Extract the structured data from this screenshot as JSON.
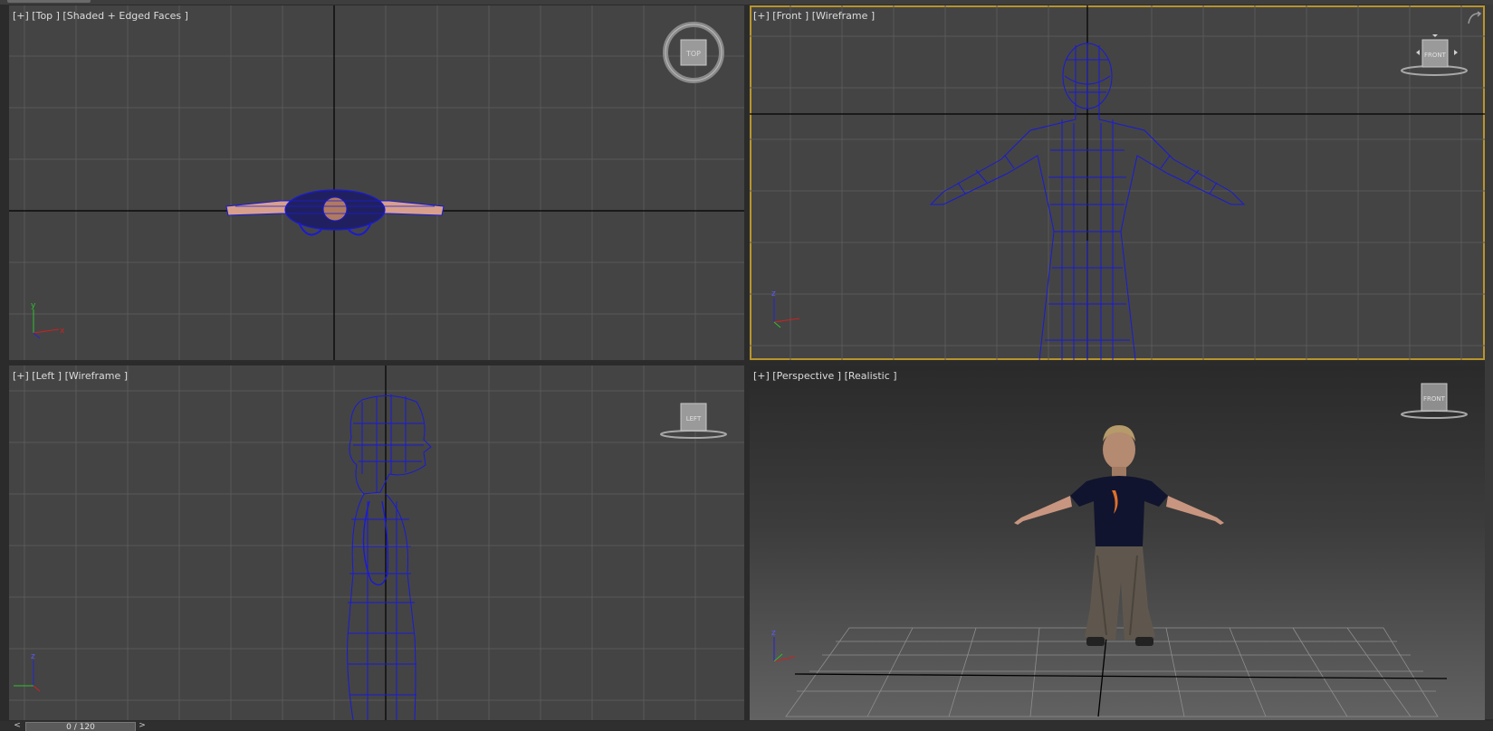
{
  "viewports": {
    "top": {
      "label": "[+] [Top ] [Shaded + Edged Faces ]",
      "cube": "TOP"
    },
    "front": {
      "label": "[+] [Front ] [Wireframe ]",
      "cube": "FRONT"
    },
    "left": {
      "label": "[+] [Left ] [Wireframe ]",
      "cube": "LEFT"
    },
    "perspective": {
      "label": "[+] [Perspective ] [Realistic ]",
      "cube": "FRONT"
    }
  },
  "timeline": {
    "frame": "0 / 120",
    "prev": "<",
    "next": ">"
  },
  "colors": {
    "viewport_bg": "#444444",
    "wire": "#1a1ad8",
    "active_border": "#b8952c",
    "grid": "#595959",
    "axis": "#000000"
  }
}
